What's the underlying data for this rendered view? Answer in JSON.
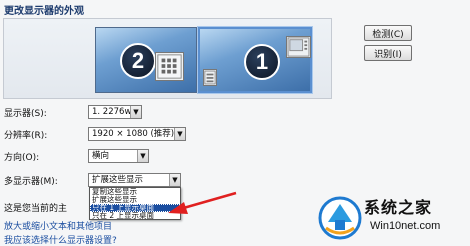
{
  "page": {
    "title": "更改显示器的外观"
  },
  "monitors": [
    {
      "number": "2",
      "selected": false
    },
    {
      "number": "1",
      "selected": true
    }
  ],
  "buttons": {
    "detect": "检测(C)",
    "identify": "识别(I)"
  },
  "form": {
    "display_label": "显示器(S):",
    "display_value": "1. 2276w",
    "resolution_label": "分辨率(R):",
    "resolution_value": "1920 × 1080 (推荐)",
    "orientation_label": "方向(O):",
    "orientation_value": "横向",
    "multi_label": "多显示器(M):",
    "multi_value": "扩展这些显示"
  },
  "dropdown": {
    "options": [
      "复制这些显示",
      "扩展这些显示",
      "只在 1 上显示桌面",
      "只在 2 上显示桌面"
    ],
    "highlighted_index": 2
  },
  "partial_text": "这是您当前的主",
  "links": [
    "放大或缩小文本和其他项目",
    "我应该选择什么显示器设置?"
  ],
  "watermark": {
    "name": "系统之家",
    "url": "Win10net.com"
  },
  "colors": {
    "accent": "#1b4ea0",
    "arrow": "#e02020",
    "monitor_blue": "#3d6fa9"
  }
}
